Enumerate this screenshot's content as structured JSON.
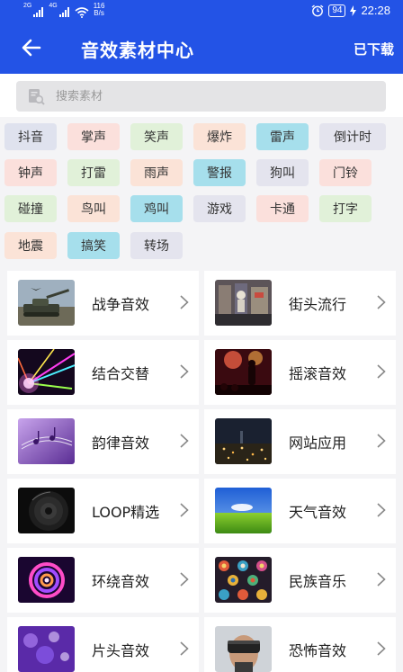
{
  "status_bar": {
    "signal_1": "2G",
    "signal_2": "4G",
    "speed_value": "116",
    "speed_unit": "B/s",
    "battery": "94",
    "time": "22:28"
  },
  "header": {
    "title": "音效素材中心",
    "downloaded_label": "已下载"
  },
  "search": {
    "placeholder": "搜索素材"
  },
  "tags": [
    {
      "label": "抖音",
      "color": "#dfe2ee"
    },
    {
      "label": "掌声",
      "color": "#fbe0dc"
    },
    {
      "label": "笑声",
      "color": "#e1f1d9"
    },
    {
      "label": "爆炸",
      "color": "#fbe3d7"
    },
    {
      "label": "雷声",
      "color": "#a6dfec"
    },
    {
      "label": "倒计时",
      "color": "#e4e4ee"
    },
    {
      "label": "钟声",
      "color": "#fbe0dc"
    },
    {
      "label": "打雷",
      "color": "#e1f1d9"
    },
    {
      "label": "雨声",
      "color": "#fbe3d7"
    },
    {
      "label": "警报",
      "color": "#a6dfec"
    },
    {
      "label": "狗叫",
      "color": "#e4e4ee"
    },
    {
      "label": "门铃",
      "color": "#fbe0dc"
    },
    {
      "label": "碰撞",
      "color": "#e1f1d9"
    },
    {
      "label": "鸟叫",
      "color": "#fbe3d7"
    },
    {
      "label": "鸡叫",
      "color": "#a6dfec"
    },
    {
      "label": "游戏",
      "color": "#e4e4ee"
    },
    {
      "label": "卡通",
      "color": "#fbe0dc"
    },
    {
      "label": "打字",
      "color": "#e1f1d9"
    },
    {
      "label": "地震",
      "color": "#fbe3d7"
    },
    {
      "label": "搞笑",
      "color": "#a6dfec"
    },
    {
      "label": "转场",
      "color": "#e4e4ee"
    }
  ],
  "categories": [
    {
      "label": "战争音效",
      "icon": "war-tank-icon"
    },
    {
      "label": "街头流行",
      "icon": "street-art-icon"
    },
    {
      "label": "结合交替",
      "icon": "laser-lights-icon"
    },
    {
      "label": "摇滚音效",
      "icon": "rock-concert-icon"
    },
    {
      "label": "韵律音效",
      "icon": "purple-music-notes-icon"
    },
    {
      "label": "网站应用",
      "icon": "city-night-icon"
    },
    {
      "label": "LOOP精选",
      "icon": "speaker-icon"
    },
    {
      "label": "天气音效",
      "icon": "sky-meadow-icon"
    },
    {
      "label": "环绕音效",
      "icon": "colorful-swirl-icon"
    },
    {
      "label": "民族音乐",
      "icon": "ethnic-pattern-icon"
    },
    {
      "label": "片头音效",
      "icon": "purple-bokeh-icon"
    },
    {
      "label": "恐怖音效",
      "icon": "vr-headset-icon"
    }
  ],
  "colors": {
    "primary": "#2353e6",
    "background": "#f4f4f6",
    "card": "#ffffff"
  }
}
